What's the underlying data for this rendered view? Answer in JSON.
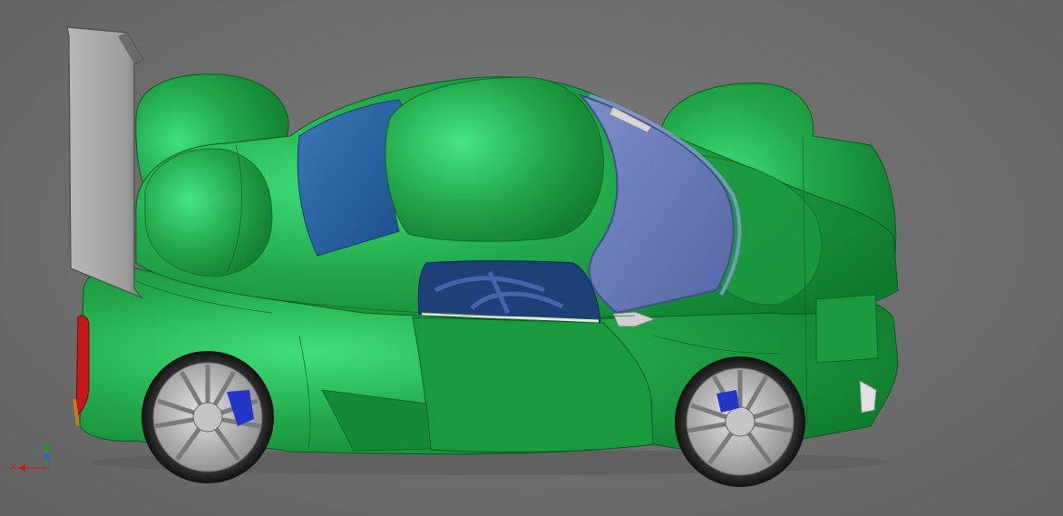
{
  "viewport": {
    "background": "#6d6d6d",
    "model": {
      "name": "race car body",
      "body_color": "#1e9a3c",
      "body_highlight": "#3fe07a",
      "glass_color": "#6678b4",
      "wing_color": "#9a9a9a",
      "wheel_color": "#b9b9b9",
      "brake_caliper_color": "#2436c8",
      "taillight_color": "#c81818"
    },
    "triad": {
      "x_label": "x",
      "x_color": "#d21414",
      "y_color": "#18a028"
    }
  }
}
